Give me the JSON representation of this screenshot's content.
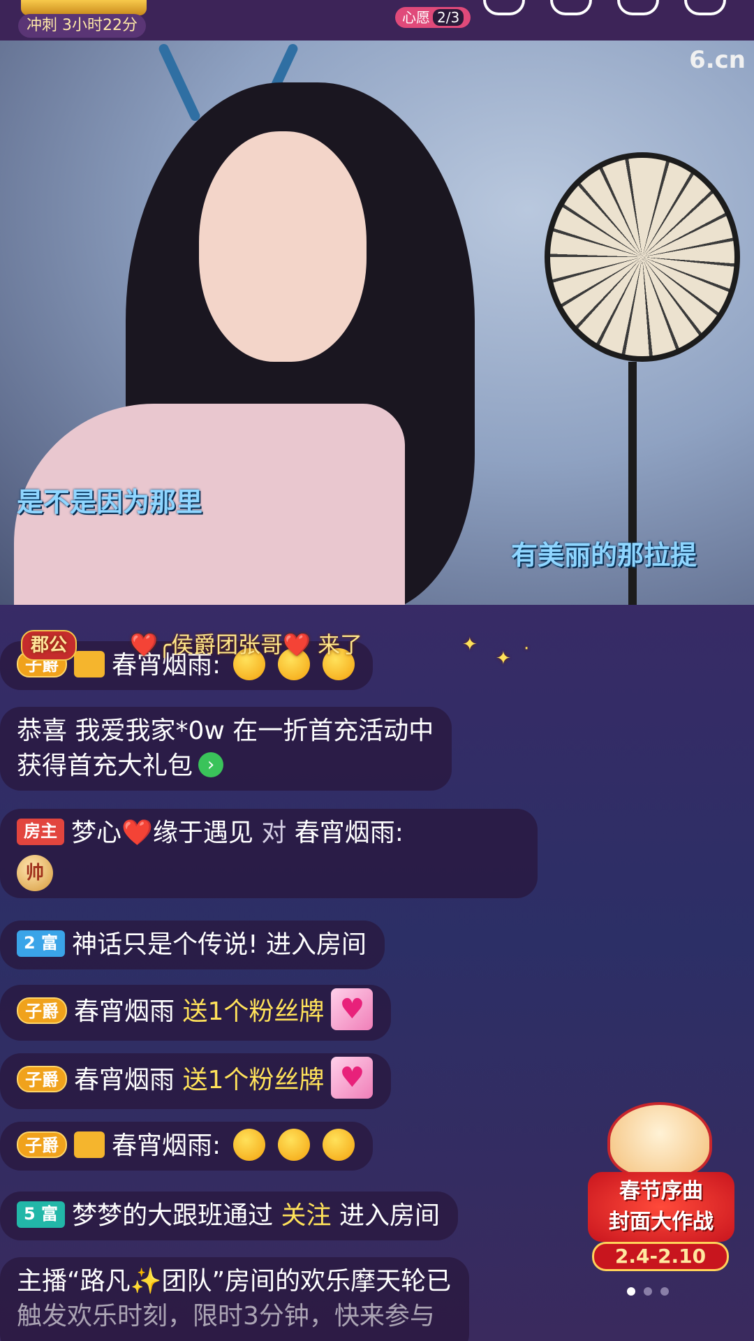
{
  "topbar": {
    "sprint_label": "冲刺 3小时22分",
    "wish_label": "心愿",
    "wish_count": "2/3"
  },
  "video": {
    "logo": "6.cn",
    "lyric_left": "是不是因为那里",
    "lyric_right": "有美丽的那拉提"
  },
  "entrance": {
    "badge": "郡公",
    "text": "❤️╭侯爵团张哥❤️ 来了"
  },
  "chat": {
    "m1": {
      "badge": "子爵",
      "user": "春宵烟雨:"
    },
    "m2": {
      "line1": "恭喜 我爱我家*0w 在一折首充活动中",
      "line2": "获得首充大礼包"
    },
    "m3": {
      "badge": "房主",
      "user": "梦心",
      "heart": "❤️",
      "user2": "缘于遇见",
      "to": "对",
      "target": "春宵烟雨:",
      "sticker": "帅"
    },
    "m4": {
      "badge": "2 富",
      "text": "神话只是个传说! 进入房间"
    },
    "m5": {
      "badge": "子爵",
      "user": "春宵烟雨",
      "action": "送1个粉丝牌"
    },
    "m6": {
      "badge": "子爵",
      "user": "春宵烟雨",
      "action": "送1个粉丝牌"
    },
    "m7": {
      "badge": "子爵",
      "user": "春宵烟雨:"
    },
    "m8": {
      "badge": "5 富",
      "user": "梦梦的大跟班通过",
      "action": "关注",
      "tail": "进入房间"
    },
    "m9": {
      "line1": "主播“路凡✨团队”房间的欢乐摩天轮已",
      "line2": "触发欢乐时刻，限时3分钟，快来参与"
    }
  },
  "promo": {
    "title_line1": "春节序曲",
    "title_line2": "封面大作战",
    "date": "2.4-2.10"
  },
  "colors": {
    "accent_yellow": "#ffe25a",
    "host_red": "#e2453e",
    "rich_blue": "#3aa4e8",
    "rich_teal": "#22b7a8"
  }
}
